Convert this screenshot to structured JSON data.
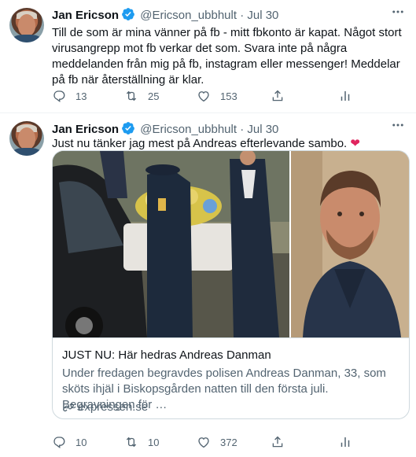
{
  "colors": {
    "accent": "#1d9bf0",
    "secondary_text": "#536471",
    "heart": "#e0245e"
  },
  "tweets": [
    {
      "author_name": "Jan Ericson",
      "handle": "@Ericson_ubbhult",
      "separator": "·",
      "date": "Jul 30",
      "text": "Till de som är mina vänner på fb - mitt fbkonto är kapat. Något stort virusangrepp mot fb verkar det som. Svara inte på några meddelanden från mig på fb, instagram eller messenger! Meddelar på fb när återställning är klar.",
      "replies": "13",
      "retweets": "25",
      "likes": "153"
    },
    {
      "author_name": "Jan Ericson",
      "handle": "@Ericson_ubbhult",
      "separator": "·",
      "date": "Jul 30",
      "text": "Just nu tänker jag mest på Andreas efterlevande sambo.",
      "emoji": "❤",
      "card": {
        "title": "JUST NU: Här hedras Andreas Danman",
        "description": "Under fredagen begravdes polisen Andreas Danman, 33, som sköts ihjäl i Biskopsgården natten till den första juli. Begravningen för …",
        "domain": "expressen.se"
      },
      "replies": "10",
      "retweets": "10",
      "likes": "372"
    }
  ],
  "icons": {
    "verified": "verified-badge-icon",
    "more": "more-icon",
    "reply": "reply-icon",
    "retweet": "retweet-icon",
    "like": "heart-icon",
    "share": "share-icon",
    "analytics": "analytics-icon",
    "link": "link-icon"
  }
}
